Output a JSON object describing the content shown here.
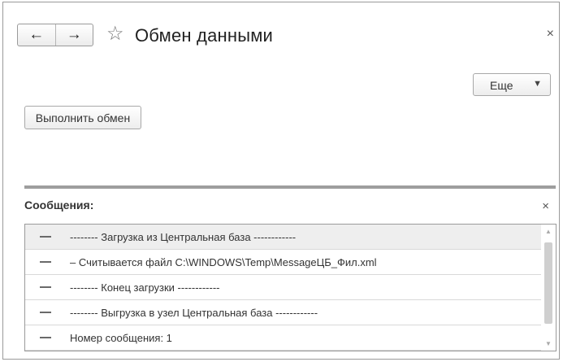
{
  "window": {
    "title": "Обмен данными",
    "close_glyph": "×",
    "nav": {
      "back_glyph": "←",
      "forward_glyph": "→"
    },
    "star_glyph": "☆"
  },
  "toolbar": {
    "more_label": "Еще",
    "more_arrow": "▼",
    "execute_label": "Выполнить обмен"
  },
  "messages": {
    "title": "Сообщения:",
    "close_glyph": "×",
    "items": [
      {
        "text": "-------- Загрузка из Центральная база ------------"
      },
      {
        "text": " – Считывается файл C:\\WINDOWS\\Temp\\MessageЦБ_Фил.xml"
      },
      {
        "text": "-------- Конец загрузки ------------"
      },
      {
        "text": "-------- Выгрузка в узел Центральная база ------------"
      },
      {
        "text": " Номер сообщения: 1"
      }
    ],
    "scroll_up_glyph": "▲",
    "scroll_down_glyph": "▼"
  },
  "icons": {
    "back": "arrow-left-icon",
    "forward": "arrow-right-icon",
    "favorite": "star-icon",
    "close": "close-icon",
    "dropdown": "chevron-down-icon",
    "message_dash": "dash-icon"
  }
}
